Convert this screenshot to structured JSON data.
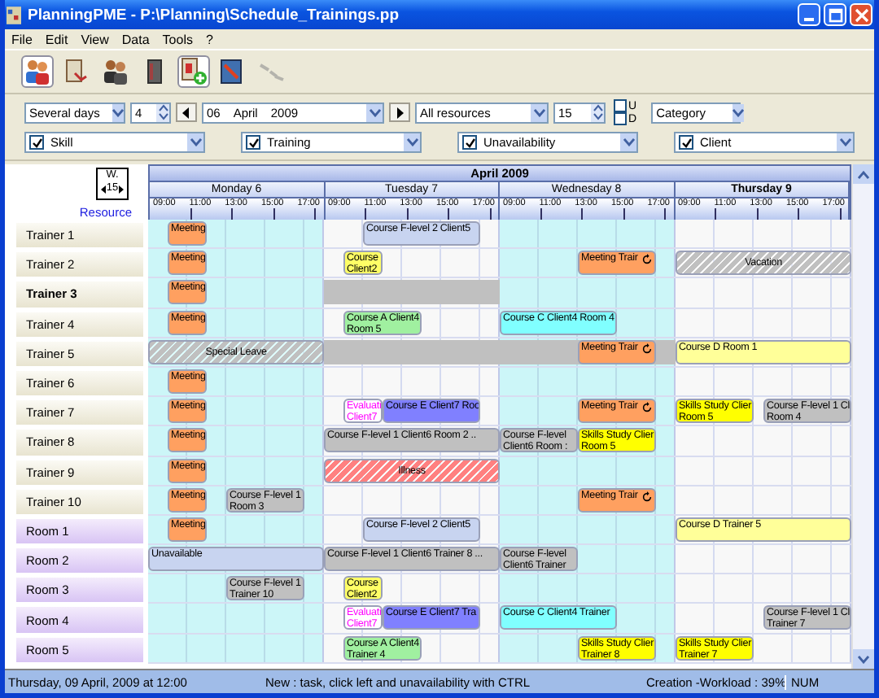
{
  "window": {
    "title": "PlanningPME - P:\\Planning\\Schedule_Trainings.pp"
  },
  "menu": [
    "File",
    "Edit",
    "View",
    "Data",
    "Tools",
    "?"
  ],
  "toolbar": [
    {
      "kind": "people",
      "selected": true,
      "disabled": false
    },
    {
      "kind": "document",
      "selected": false,
      "disabled": false
    },
    {
      "kind": "group",
      "selected": false,
      "disabled": false
    },
    {
      "kind": "book",
      "selected": false,
      "disabled": false
    },
    {
      "kind": "add",
      "selected": true,
      "disabled": false
    },
    {
      "kind": "board",
      "selected": false,
      "disabled": false
    },
    {
      "kind": "link",
      "selected": false,
      "disabled": true
    }
  ],
  "controls": {
    "view": "Several days",
    "count": "4",
    "day": "06",
    "month": "April",
    "year": "2009",
    "resources": "All resources",
    "step": "15",
    "u": {
      "label": "U",
      "checked": false
    },
    "d": {
      "label": "D",
      "checked": false
    },
    "sort": "Category"
  },
  "filters": [
    {
      "label": "Skill",
      "checked": true
    },
    {
      "label": "Training",
      "checked": true
    },
    {
      "label": "Unavailability",
      "checked": true
    },
    {
      "label": "Client",
      "checked": true
    }
  ],
  "week": {
    "label": "W.",
    "number": "15"
  },
  "resource_heading": "Resource",
  "month": "April 2009",
  "days": [
    {
      "label": "Monday 6",
      "shaded": true,
      "today": false,
      "hours": [
        "09:00",
        "11:00",
        "13:00",
        "15:00",
        "17:00"
      ]
    },
    {
      "label": "Tuesday 7",
      "shaded": false,
      "today": false,
      "hours": [
        "09:00",
        "11:00",
        "13:00",
        "15:00",
        "17:00"
      ]
    },
    {
      "label": "Wednesday 8",
      "shaded": true,
      "today": false,
      "hours": [
        "09:00",
        "11:00",
        "13:00",
        "15:00",
        "17:00"
      ]
    },
    {
      "label": "Thursday 9",
      "shaded": false,
      "today": true,
      "hours": [
        "09:00",
        "11:00",
        "13:00",
        "15:00",
        "17:00"
      ]
    }
  ],
  "rows": [
    {
      "name": "Trainer 1",
      "kind": "trainer",
      "selected": false,
      "events": [
        {
          "kind": "task",
          "color": "#ffa060",
          "lines": [
            "Meeting"
          ],
          "recurring": false
        },
        {
          "kind": "task",
          "color": "#c8d4f0",
          "lines": [
            "Course F-level 2 Client5"
          ],
          "recurring": false
        }
      ]
    },
    {
      "name": "Trainer 2",
      "kind": "trainer",
      "selected": false,
      "events": [
        {
          "kind": "task",
          "color": "#ffa060",
          "lines": [
            "Meeting"
          ],
          "recurring": false
        },
        {
          "kind": "task",
          "color": "#ffff66",
          "lines": [
            "Course",
            "Client2"
          ],
          "recurring": false
        },
        {
          "kind": "task",
          "color": "#ffa060",
          "lines": [
            "Meeting Trair"
          ],
          "recurring": true
        },
        {
          "kind": "absence",
          "color": "#c0c0c0",
          "lines": [
            "Vacation"
          ],
          "recurring": false
        }
      ]
    },
    {
      "name": "Trainer 3",
      "kind": "trainer",
      "selected": true,
      "events": [
        {
          "kind": "task",
          "color": "#ffa060",
          "lines": [
            "Meeting"
          ],
          "recurring": false
        },
        {
          "kind": "block",
          "color": "#c0c0c0",
          "recurring": false
        }
      ]
    },
    {
      "name": "Trainer 4",
      "kind": "trainer",
      "selected": false,
      "events": [
        {
          "kind": "task",
          "color": "#ffa060",
          "lines": [
            "Meeting"
          ],
          "recurring": false
        },
        {
          "kind": "task",
          "color": "#a0f0a0",
          "lines": [
            "Course A Client4",
            "Room 5"
          ],
          "recurring": false
        },
        {
          "kind": "task",
          "color": "#80ffff",
          "lines": [
            "Course C Client4 Room 4"
          ],
          "recurring": false
        }
      ]
    },
    {
      "name": "Trainer 5",
      "kind": "trainer",
      "selected": false,
      "events": [
        {
          "kind": "absence",
          "color": "#c0c0c0",
          "lines": [
            "Special Leave"
          ],
          "recurring": false
        },
        {
          "kind": "block",
          "color": "#c0c0c0",
          "recurring": false
        },
        {
          "kind": "block",
          "color": "#c0c0c0",
          "recurring": false
        },
        {
          "kind": "task",
          "color": "#ffa060",
          "lines": [
            "Meeting Trair"
          ],
          "recurring": true
        },
        {
          "kind": "task",
          "color": "#ffff99",
          "lines": [
            "Course D Room 1"
          ],
          "recurring": false
        }
      ]
    },
    {
      "name": "Trainer 6",
      "kind": "trainer",
      "selected": false,
      "events": [
        {
          "kind": "task",
          "color": "#ffa060",
          "lines": [
            "Meeting"
          ],
          "recurring": false
        }
      ]
    },
    {
      "name": "Trainer 7",
      "kind": "trainer",
      "selected": false,
      "events": [
        {
          "kind": "task",
          "color": "#ffa060",
          "lines": [
            "Meeting"
          ],
          "recurring": false
        },
        {
          "kind": "evaluation",
          "color": "#ff00ff",
          "lines": [
            "Evaluati",
            "Client7"
          ],
          "recurring": false
        },
        {
          "kind": "task",
          "color": "#8080ff",
          "lines": [
            "Course E Client7 Roo"
          ],
          "recurring": false
        },
        {
          "kind": "task",
          "color": "#ffa060",
          "lines": [
            "Meeting Trair"
          ],
          "recurring": true
        },
        {
          "kind": "task",
          "color": "#ffff00",
          "lines": [
            "Skills Study Clier",
            "Room 5"
          ],
          "recurring": false
        },
        {
          "kind": "task",
          "color": "#c0c0c0",
          "lines": [
            "Course F-level 1 Cl",
            "Room 4"
          ],
          "recurring": false
        }
      ]
    },
    {
      "name": "Trainer 8",
      "kind": "trainer",
      "selected": false,
      "events": [
        {
          "kind": "task",
          "color": "#ffa060",
          "lines": [
            "Meeting"
          ],
          "recurring": false
        },
        {
          "kind": "task",
          "color": "#c0c0c0",
          "lines": [
            "Course F-level 1 Client6 Room 2 .."
          ],
          "recurring": false
        },
        {
          "kind": "task",
          "color": "#c0c0c0",
          "lines": [
            "Course F-level",
            "Client6 Room :"
          ],
          "recurring": false
        },
        {
          "kind": "task",
          "color": "#ffff00",
          "lines": [
            "Skills Study Clier",
            "Room 5"
          ],
          "recurring": false
        }
      ]
    },
    {
      "name": "Trainer 9",
      "kind": "trainer",
      "selected": false,
      "events": [
        {
          "kind": "task",
          "color": "#ffa060",
          "lines": [
            "Meeting"
          ],
          "recurring": false
        },
        {
          "kind": "absence",
          "color": "#ff8080",
          "lines": [
            "Illness"
          ],
          "recurring": false
        }
      ]
    },
    {
      "name": "Trainer 10",
      "kind": "trainer",
      "selected": false,
      "events": [
        {
          "kind": "task",
          "color": "#ffa060",
          "lines": [
            "Meeting"
          ],
          "recurring": false
        },
        {
          "kind": "task",
          "color": "#c0c0c0",
          "lines": [
            "Course F-level 1",
            "Room 3"
          ],
          "recurring": false
        },
        {
          "kind": "task",
          "color": "#ffa060",
          "lines": [
            "Meeting Trair"
          ],
          "recurring": true
        }
      ]
    },
    {
      "name": "Room 1",
      "kind": "room",
      "selected": false,
      "events": [
        {
          "kind": "task",
          "color": "#ffa060",
          "lines": [
            "Meeting"
          ],
          "recurring": false
        },
        {
          "kind": "task",
          "color": "#c8d4f0",
          "lines": [
            "Course F-level 2 Client5"
          ],
          "recurring": false
        },
        {
          "kind": "task",
          "color": "#ffff99",
          "lines": [
            "Course D Trainer 5"
          ],
          "recurring": false
        }
      ]
    },
    {
      "name": "Room 2",
      "kind": "room",
      "selected": false,
      "events": [
        {
          "kind": "task",
          "color": "#c8d4f0",
          "lines": [
            "Unavailable"
          ],
          "recurring": false
        },
        {
          "kind": "task",
          "color": "#c0c0c0",
          "lines": [
            "Course F-level 1 Client6 Trainer 8 ..."
          ],
          "recurring": false
        },
        {
          "kind": "task",
          "color": "#c0c0c0",
          "lines": [
            "Course F-level",
            "Client6 Trainer"
          ],
          "recurring": false
        }
      ]
    },
    {
      "name": "Room 3",
      "kind": "room",
      "selected": false,
      "events": [
        {
          "kind": "task",
          "color": "#c0c0c0",
          "lines": [
            "Course F-level 1",
            "Trainer 10"
          ],
          "recurring": false
        },
        {
          "kind": "task",
          "color": "#ffff66",
          "lines": [
            "Course",
            "Client2"
          ],
          "recurring": false
        }
      ]
    },
    {
      "name": "Room 4",
      "kind": "room",
      "selected": false,
      "events": [
        {
          "kind": "evaluation",
          "color": "#ff00ff",
          "lines": [
            "Evaluati",
            "Client7"
          ],
          "recurring": false
        },
        {
          "kind": "task",
          "color": "#8080ff",
          "lines": [
            "Course E Client7 Tra"
          ],
          "recurring": false
        },
        {
          "kind": "task",
          "color": "#80ffff",
          "lines": [
            "Course C Client4 Trainer"
          ],
          "recurring": false
        },
        {
          "kind": "task",
          "color": "#c0c0c0",
          "lines": [
            "Course F-level 1 Cl",
            "Trainer 7"
          ],
          "recurring": false
        }
      ]
    },
    {
      "name": "Room 5",
      "kind": "room",
      "selected": false,
      "events": [
        {
          "kind": "task",
          "color": "#a0f0a0",
          "lines": [
            "Course A Client4",
            "Trainer 4"
          ],
          "recurring": false
        },
        {
          "kind": "task",
          "color": "#ffff00",
          "lines": [
            "Skills Study Clier",
            "Trainer 8"
          ],
          "recurring": false
        },
        {
          "kind": "task",
          "color": "#ffff00",
          "lines": [
            "Skills Study Clier",
            "Trainer 7"
          ],
          "recurring": false
        }
      ]
    }
  ],
  "status_bar": [
    "Thursday, 09 April, 2009 at 12:00",
    "New : task, click left and unavailability with CTRL",
    "Creation -Workload : 39%",
    "NUM"
  ]
}
